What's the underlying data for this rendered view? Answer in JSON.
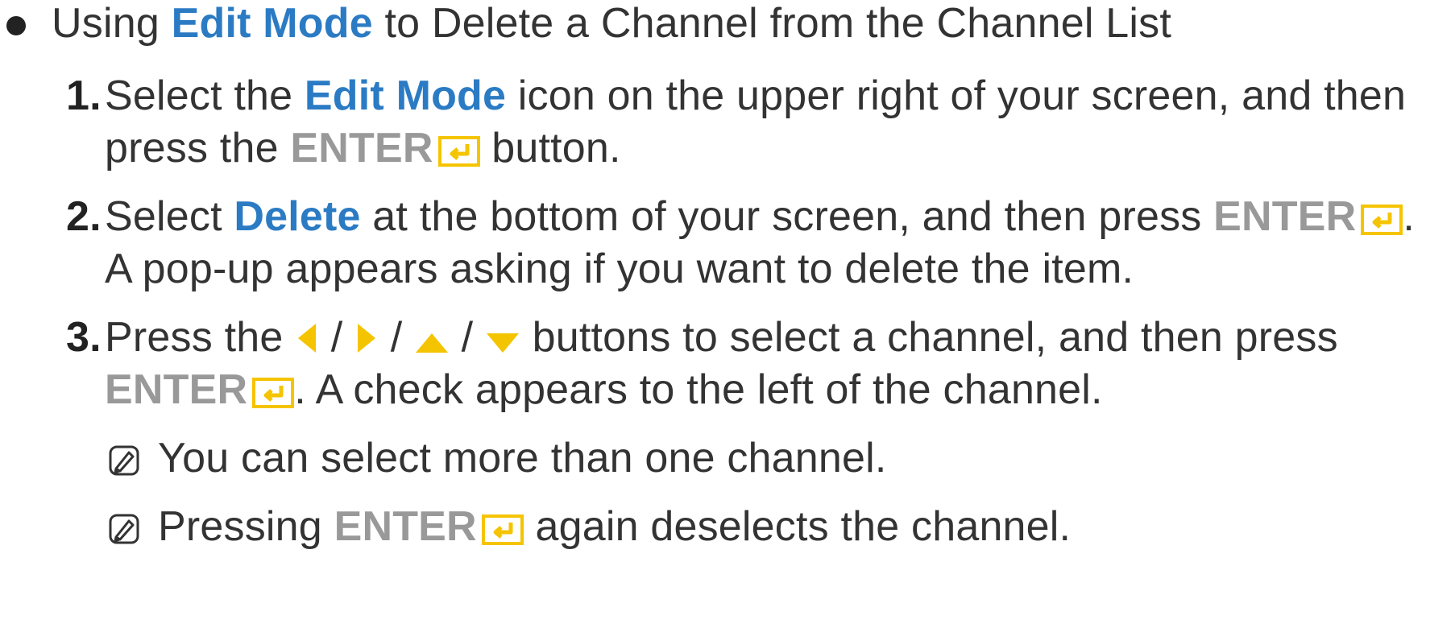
{
  "accent_blue": "#2b7bc4",
  "accent_gray": "#999999",
  "icon_yellow": "#f5c400",
  "heading": {
    "prefix": "Using ",
    "highlight": "Edit Mode",
    "suffix": " to Delete a Channel from the Channel List"
  },
  "steps": [
    {
      "number": "1.",
      "line1_a": "Select the ",
      "line1_highlight": "Edit Mode",
      "line1_b": " icon on the upper right of your screen, and then",
      "line2_a": "press the ",
      "enter": "ENTER",
      "line2_b": " button."
    },
    {
      "number": "2.",
      "line1_a": "Select ",
      "line1_highlight": "Delete",
      "line1_b": " at the bottom of your screen, and then press ",
      "enter": "ENTER",
      "line1_c": ".",
      "line2": "A pop-up appears asking if you want to delete the item."
    },
    {
      "number": "3.",
      "line1_a": "Press the ",
      "sep": " / ",
      "line1_b": " buttons to select a channel, and then press",
      "enter": "ENTER",
      "line2_b": ". A check appears to the left of the channel."
    }
  ],
  "notes": [
    {
      "icon": "note-icon",
      "text": "You can select more than one channel."
    },
    {
      "icon": "note-icon",
      "prefix": "Pressing ",
      "enter": "ENTER",
      "suffix": " again deselects the channel."
    }
  ],
  "icons": {
    "enter": "enter-key-icon",
    "left": "left-arrow-icon",
    "right": "right-arrow-icon",
    "up": "up-arrow-icon",
    "down": "down-arrow-icon"
  }
}
